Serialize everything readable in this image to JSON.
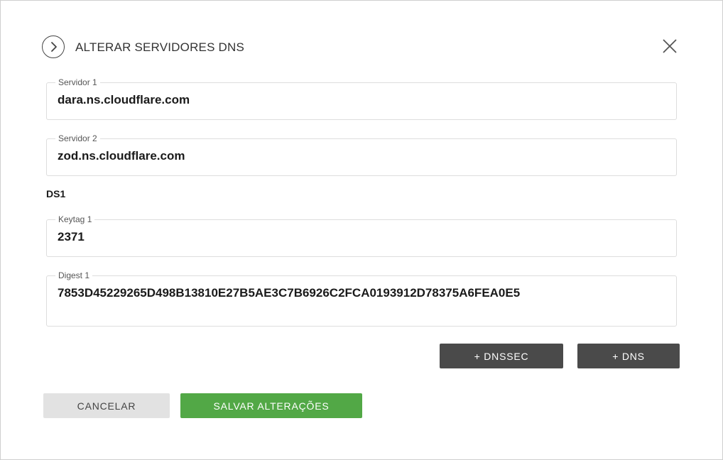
{
  "dialog": {
    "title": "ALTERAR SERVIDORES DNS"
  },
  "fields": {
    "server1": {
      "label": "Servidor 1",
      "value": "dara.ns.cloudflare.com"
    },
    "server2": {
      "label": "Servidor 2",
      "value": "zod.ns.cloudflare.com"
    },
    "ds_section_title": "DS1",
    "keytag1": {
      "label": "Keytag 1",
      "value": "2371"
    },
    "digest1": {
      "label": "Digest 1",
      "value": "7853D45229265D498B13810E27B5AE3C7B6926C2FCA0193912D78375A6FEA0E5"
    }
  },
  "actions": {
    "add_dnssec": "+ DNSSEC",
    "add_dns": "+ DNS",
    "cancel": "CANCELAR",
    "save": "SALVAR ALTERAÇÕES"
  },
  "icons": {
    "toggle": "chevron-right-icon",
    "close": "close-icon"
  },
  "colors": {
    "save_button": "#52a846",
    "dark_button": "#4a4a4a",
    "cancel_button": "#e2e2e2"
  }
}
